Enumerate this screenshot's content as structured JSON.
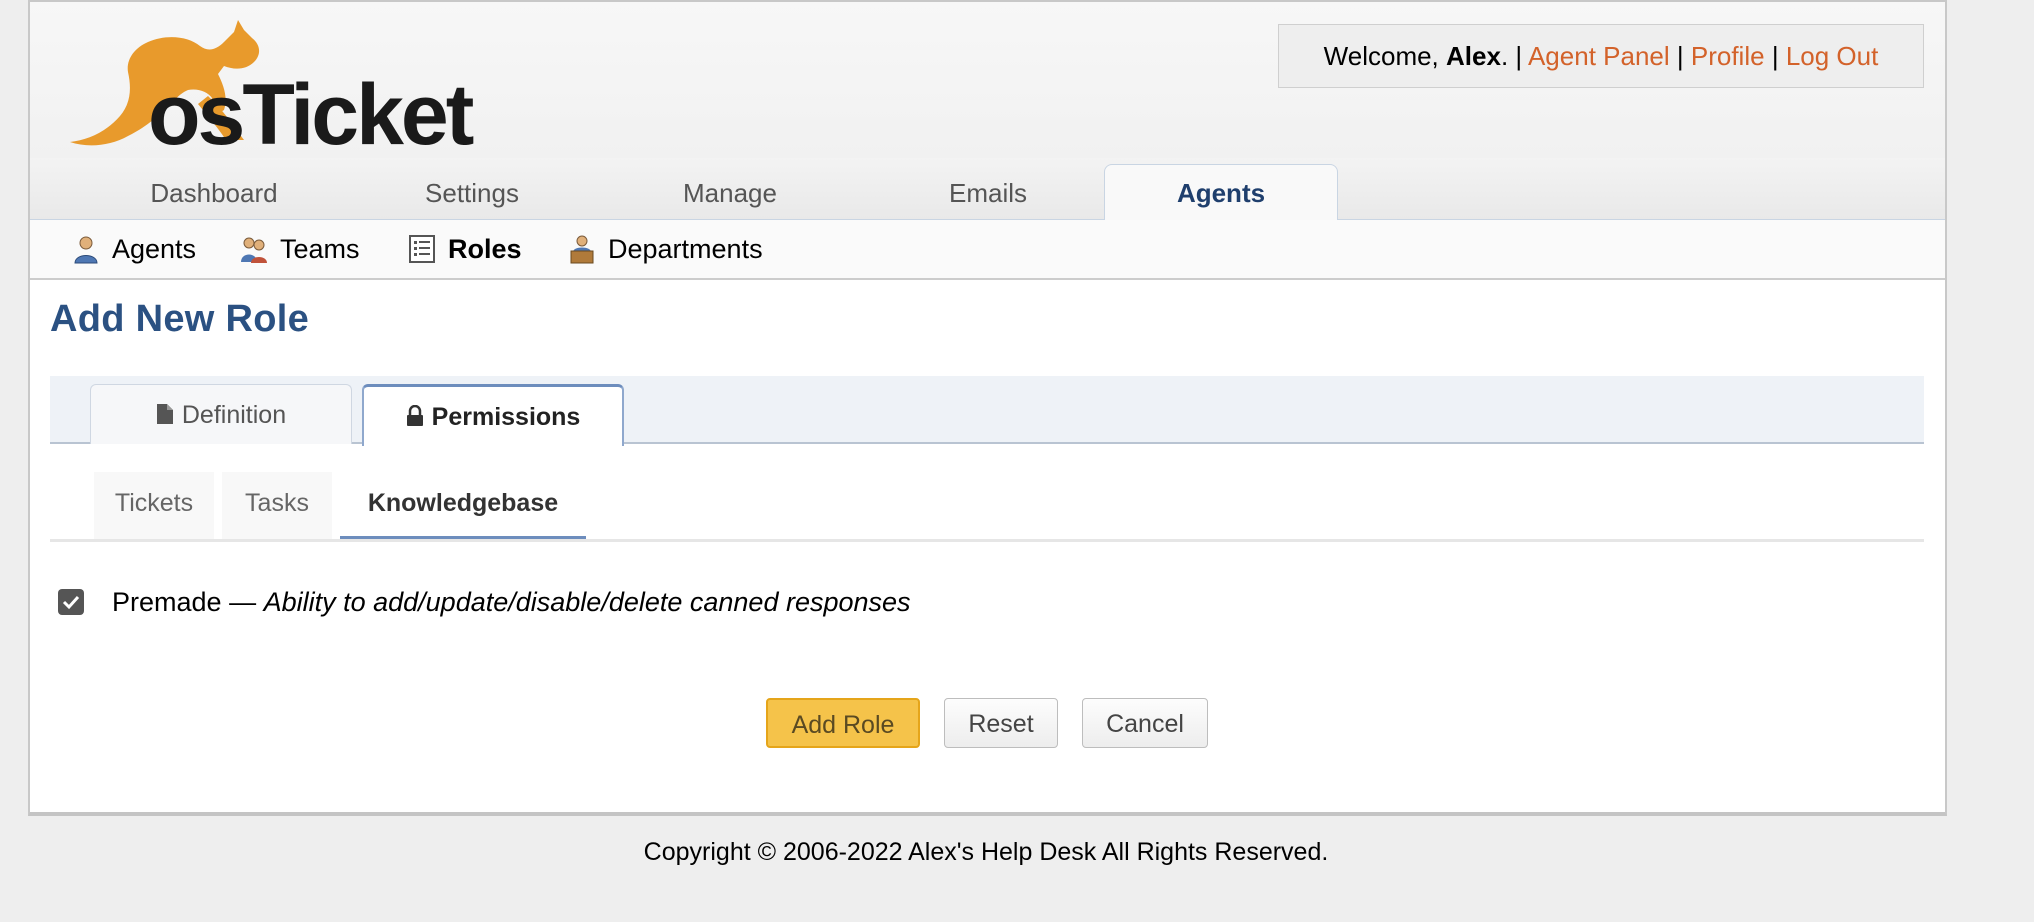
{
  "header": {
    "logo_text": "osTicket",
    "welcome_prefix": "Welcome, ",
    "user_name": "Alex",
    "welcome_suffix": ".",
    "separator": "|",
    "links": [
      "Agent Panel",
      "Profile",
      "Log Out"
    ],
    "link_color": "#d3622a"
  },
  "nav": {
    "tabs": [
      "Dashboard",
      "Settings",
      "Manage",
      "Emails",
      "Agents"
    ],
    "active": "Agents"
  },
  "subnav": {
    "items": [
      {
        "label": "Agents",
        "icon": "agent-icon"
      },
      {
        "label": "Teams",
        "icon": "teams-icon"
      },
      {
        "label": "Roles",
        "icon": "roles-icon"
      },
      {
        "label": "Departments",
        "icon": "departments-icon"
      }
    ],
    "active": "Roles"
  },
  "page": {
    "title": "Add New Role"
  },
  "tabs": {
    "items": [
      {
        "label": "Definition",
        "icon": "document-icon"
      },
      {
        "label": "Permissions",
        "icon": "lock-icon"
      }
    ],
    "active": "Permissions"
  },
  "subtabs": {
    "items": [
      "Tickets",
      "Tasks",
      "Knowledgebase"
    ],
    "active": "Knowledgebase"
  },
  "permission": {
    "name": "Premade",
    "dash": " — ",
    "description": "Ability to add/update/disable/delete canned responses",
    "checked": true
  },
  "buttons": {
    "add": "Add Role",
    "reset": "Reset",
    "cancel": "Cancel"
  },
  "footer": {
    "text": "Copyright © 2006-2022 Alex's Help Desk All Rights Reserved."
  },
  "colors": {
    "title": "#2b5182",
    "accent": "#f5c34a",
    "logo_orange": "#e89a2c"
  }
}
